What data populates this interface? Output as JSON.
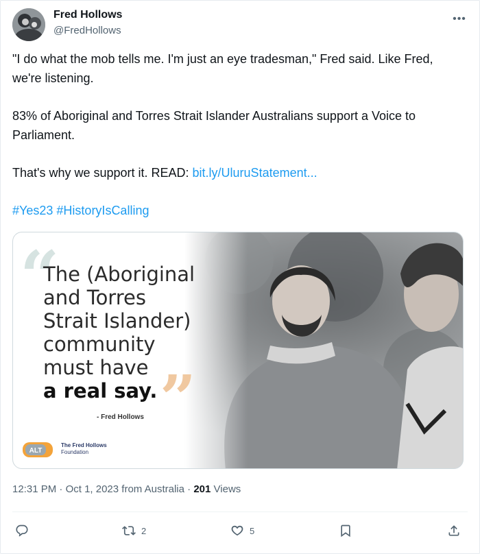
{
  "author": {
    "name": "Fred Hollows",
    "handle": "@FredHollows"
  },
  "tweet": {
    "paragraph1": "\"I do what the mob tells me. I'm just an eye tradesman,\" Fred said. Like Fred, we're listening.",
    "paragraph2": "83% of Aboriginal and Torres Strait Islander Australians support a Voice to Parliament.",
    "paragraph3_prefix": "That's why we support it. READ: ",
    "link": "bit.ly/UluruStatement...",
    "hashtag1": "#Yes23",
    "hashtag2": "#HistoryIsCalling"
  },
  "media": {
    "quote_line1": "The (Aboriginal",
    "quote_line2": "and Torres",
    "quote_line3": "Strait Islander)",
    "quote_line4": "community",
    "quote_line5": "must have",
    "quote_line6": "a real say.",
    "attribution": "- Fred Hollows",
    "logo_text": "ALT",
    "org_line1": "The Fred Hollows",
    "org_line2": "Foundation"
  },
  "meta": {
    "time": "12:31 PM",
    "separator": "·",
    "date": "Oct 1, 2023 from Australia",
    "views_count": "201",
    "views_label": "Views"
  },
  "actions": {
    "reply_count": "",
    "retweet_count": "2",
    "like_count": "5",
    "bookmark_count": "",
    "share_count": ""
  },
  "icons": [
    "more-icon",
    "reply-icon",
    "retweet-icon",
    "like-icon",
    "bookmark-icon",
    "share-icon"
  ],
  "colors": {
    "link": "#1d9bf0",
    "secondary_text": "#536471",
    "primary_text": "#0f1419"
  }
}
